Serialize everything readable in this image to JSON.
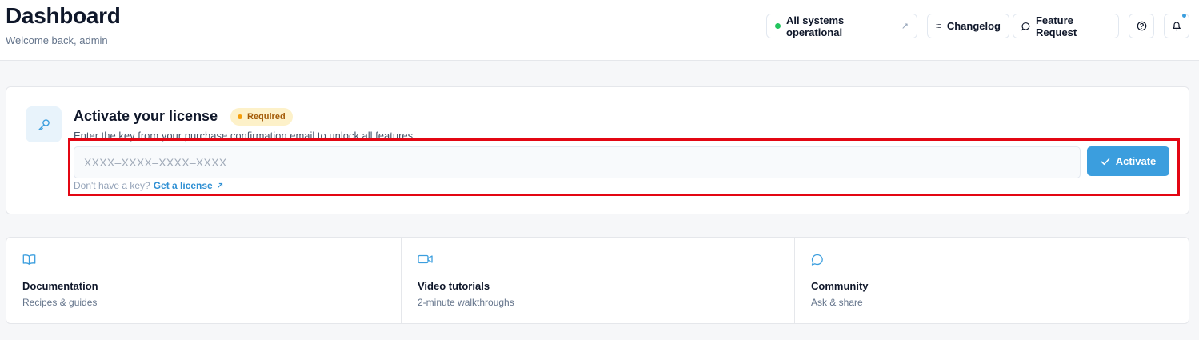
{
  "header": {
    "title": "Dashboard",
    "subtitle": "Welcome back, admin",
    "status_label": "All systems operational",
    "changelog_label": "Changelog",
    "feature_request_label": "Feature Request"
  },
  "license": {
    "title": "Activate your license",
    "badge": "Required",
    "description": "Enter the key from your purchase confirmation email to unlock all features.",
    "input_placeholder": "XXXX–XXXX–XXXX–XXXX",
    "input_value": "",
    "activate_label": "Activate",
    "no_key_text": "Don't have a key?",
    "get_license_label": "Get a license"
  },
  "resources": [
    {
      "title": "Documentation",
      "subtitle": "Recipes & guides",
      "icon": "book-icon"
    },
    {
      "title": "Video tutorials",
      "subtitle": "2-minute walkthroughs",
      "icon": "video-icon"
    },
    {
      "title": "Community",
      "subtitle": "Ask & share",
      "icon": "chat-bubble-icon"
    }
  ],
  "colors": {
    "accent": "#3b9ede",
    "status_ok": "#22c55e",
    "required_bg": "#fdf1c9",
    "required_text": "#a35a07",
    "highlight": "#e30613"
  }
}
